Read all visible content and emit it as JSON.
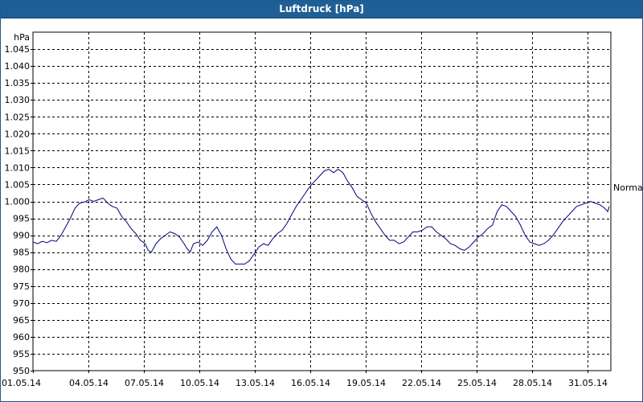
{
  "window": {
    "title": "Luftdruck [hPa]"
  },
  "chart_data": {
    "type": "line",
    "title": "Luftdruck [hPa]",
    "ylabel": "hPa",
    "xlabel": "",
    "ylim": [
      950,
      1050
    ],
    "xlim": [
      "01.05.14",
      "01.06.14"
    ],
    "grid": true,
    "y_ticks": [
      "950",
      "955",
      "960",
      "965",
      "970",
      "975",
      "980",
      "985",
      "990",
      "995",
      "1.000",
      "1.005",
      "1.010",
      "1.015",
      "1.020",
      "1.025",
      "1.030",
      "1.035",
      "1.040",
      "1.045"
    ],
    "y_tick_values": [
      950,
      955,
      960,
      965,
      970,
      975,
      980,
      985,
      990,
      995,
      1000,
      1005,
      1010,
      1015,
      1020,
      1025,
      1030,
      1035,
      1040,
      1045
    ],
    "x_ticks": [
      "01.05.14",
      "04.05.14",
      "07.05.14",
      "10.05.14",
      "13.05.14",
      "16.05.14",
      "19.05.14",
      "22.05.14",
      "25.05.14",
      "28.05.14",
      "31.05.14"
    ],
    "x_tick_values": [
      0,
      3,
      6,
      9,
      12,
      15,
      18,
      21,
      24,
      27,
      30
    ],
    "right_label": {
      "text": "Normal",
      "y": 1003.5
    },
    "series": [
      {
        "color": "#00007f",
        "points": [
          [
            0.0,
            988.0
          ],
          [
            0.3,
            987.5
          ],
          [
            0.6,
            988.2
          ],
          [
            0.9,
            987.8
          ],
          [
            1.2,
            988.5
          ],
          [
            1.5,
            988.2
          ],
          [
            1.8,
            990.0
          ],
          [
            2.1,
            992.5
          ],
          [
            2.4,
            995.0
          ],
          [
            2.7,
            998.0
          ],
          [
            3.0,
            999.5
          ],
          [
            3.3,
            999.8
          ],
          [
            3.6,
            1000.5
          ],
          [
            3.9,
            1000.0
          ],
          [
            4.2,
            1000.5
          ],
          [
            4.5,
            1001.0
          ],
          [
            4.8,
            999.5
          ],
          [
            5.1,
            998.5
          ],
          [
            5.4,
            998.0
          ],
          [
            5.7,
            995.5
          ],
          [
            6.0,
            994.0
          ],
          [
            6.3,
            992.0
          ],
          [
            6.6,
            990.5
          ],
          [
            6.9,
            988.5
          ],
          [
            7.2,
            987.5
          ],
          [
            7.4,
            985.5
          ],
          [
            7.6,
            985.0
          ],
          [
            7.9,
            987.5
          ],
          [
            8.2,
            989.0
          ],
          [
            8.5,
            990.0
          ],
          [
            8.8,
            991.0
          ],
          [
            9.1,
            990.5
          ],
          [
            9.4,
            989.5
          ],
          [
            9.7,
            987.5
          ],
          [
            9.9,
            986.0
          ],
          [
            10.1,
            985.0
          ],
          [
            10.3,
            987.5
          ],
          [
            10.6,
            988.0
          ],
          [
            10.9,
            987.0
          ],
          [
            11.2,
            988.5
          ],
          [
            11.5,
            991.0
          ],
          [
            11.8,
            992.5
          ],
          [
            12.1,
            990.0
          ],
          [
            12.4,
            986.0
          ],
          [
            12.7,
            983.0
          ],
          [
            13.0,
            981.5
          ],
          [
            13.3,
            981.5
          ],
          [
            13.6,
            981.5
          ],
          [
            13.9,
            982.5
          ],
          [
            14.2,
            984.5
          ],
          [
            14.5,
            986.5
          ],
          [
            14.8,
            987.5
          ],
          [
            15.1,
            987.0
          ],
          [
            15.4,
            989.0
          ],
          [
            15.7,
            990.5
          ],
          [
            16.0,
            991.5
          ],
          [
            16.3,
            993.5
          ],
          [
            16.6,
            996.0
          ],
          [
            16.9,
            998.5
          ],
          [
            17.2,
            1000.5
          ],
          [
            17.5,
            1002.5
          ],
          [
            17.8,
            1004.5
          ],
          [
            18.1,
            1006.0
          ],
          [
            18.4,
            1007.5
          ],
          [
            18.7,
            1009.0
          ],
          [
            19.0,
            1009.5
          ],
          [
            19.3,
            1008.5
          ],
          [
            19.6,
            1009.5
          ],
          [
            19.9,
            1008.5
          ],
          [
            20.2,
            1006.0
          ],
          [
            20.5,
            1004.0
          ],
          [
            20.8,
            1001.5
          ],
          [
            21.1,
            1000.5
          ],
          [
            21.4,
            999.5
          ],
          [
            21.7,
            996.5
          ],
          [
            22.0,
            994.0
          ],
          [
            22.3,
            992.0
          ],
          [
            22.6,
            990.0
          ],
          [
            22.9,
            988.5
          ],
          [
            23.2,
            988.5
          ],
          [
            23.5,
            987.5
          ],
          [
            23.8,
            988.0
          ],
          [
            24.1,
            989.5
          ],
          [
            24.4,
            991.0
          ],
          [
            24.7,
            991.0
          ],
          [
            25.0,
            991.5
          ],
          [
            25.3,
            992.5
          ],
          [
            25.6,
            992.5
          ],
          [
            25.9,
            991.0
          ],
          [
            26.2,
            990.0
          ],
          [
            26.5,
            989.0
          ],
          [
            26.8,
            987.5
          ],
          [
            27.1,
            987.0
          ],
          [
            27.4,
            986.0
          ],
          [
            27.7,
            985.5
          ],
          [
            28.0,
            986.5
          ],
          [
            28.3,
            988.0
          ],
          [
            28.6,
            989.5
          ],
          [
            28.9,
            990.5
          ],
          [
            29.2,
            992.0
          ],
          [
            29.5,
            993.0
          ],
          [
            29.8,
            997.0
          ],
          [
            30.1,
            999.0
          ],
          [
            30.4,
            998.5
          ],
          [
            30.7,
            997.0
          ],
          [
            31.0,
            995.5
          ],
          [
            31.3,
            993.0
          ],
          [
            31.6,
            990.0
          ],
          [
            31.9,
            988.0
          ],
          [
            32.2,
            987.5
          ],
          [
            32.5,
            987.0
          ],
          [
            32.8,
            987.5
          ],
          [
            33.1,
            988.5
          ],
          [
            33.4,
            990.0
          ],
          [
            33.7,
            992.0
          ],
          [
            34.0,
            994.0
          ],
          [
            34.3,
            995.5
          ],
          [
            34.6,
            997.0
          ],
          [
            34.9,
            998.5
          ],
          [
            35.2,
            999.0
          ],
          [
            35.5,
            999.5
          ],
          [
            35.8,
            1000.0
          ],
          [
            36.1,
            999.5
          ],
          [
            36.4,
            999.0
          ],
          [
            36.7,
            998.0
          ],
          [
            36.9,
            997.0
          ],
          [
            37.0,
            998.5
          ]
        ]
      }
    ]
  }
}
